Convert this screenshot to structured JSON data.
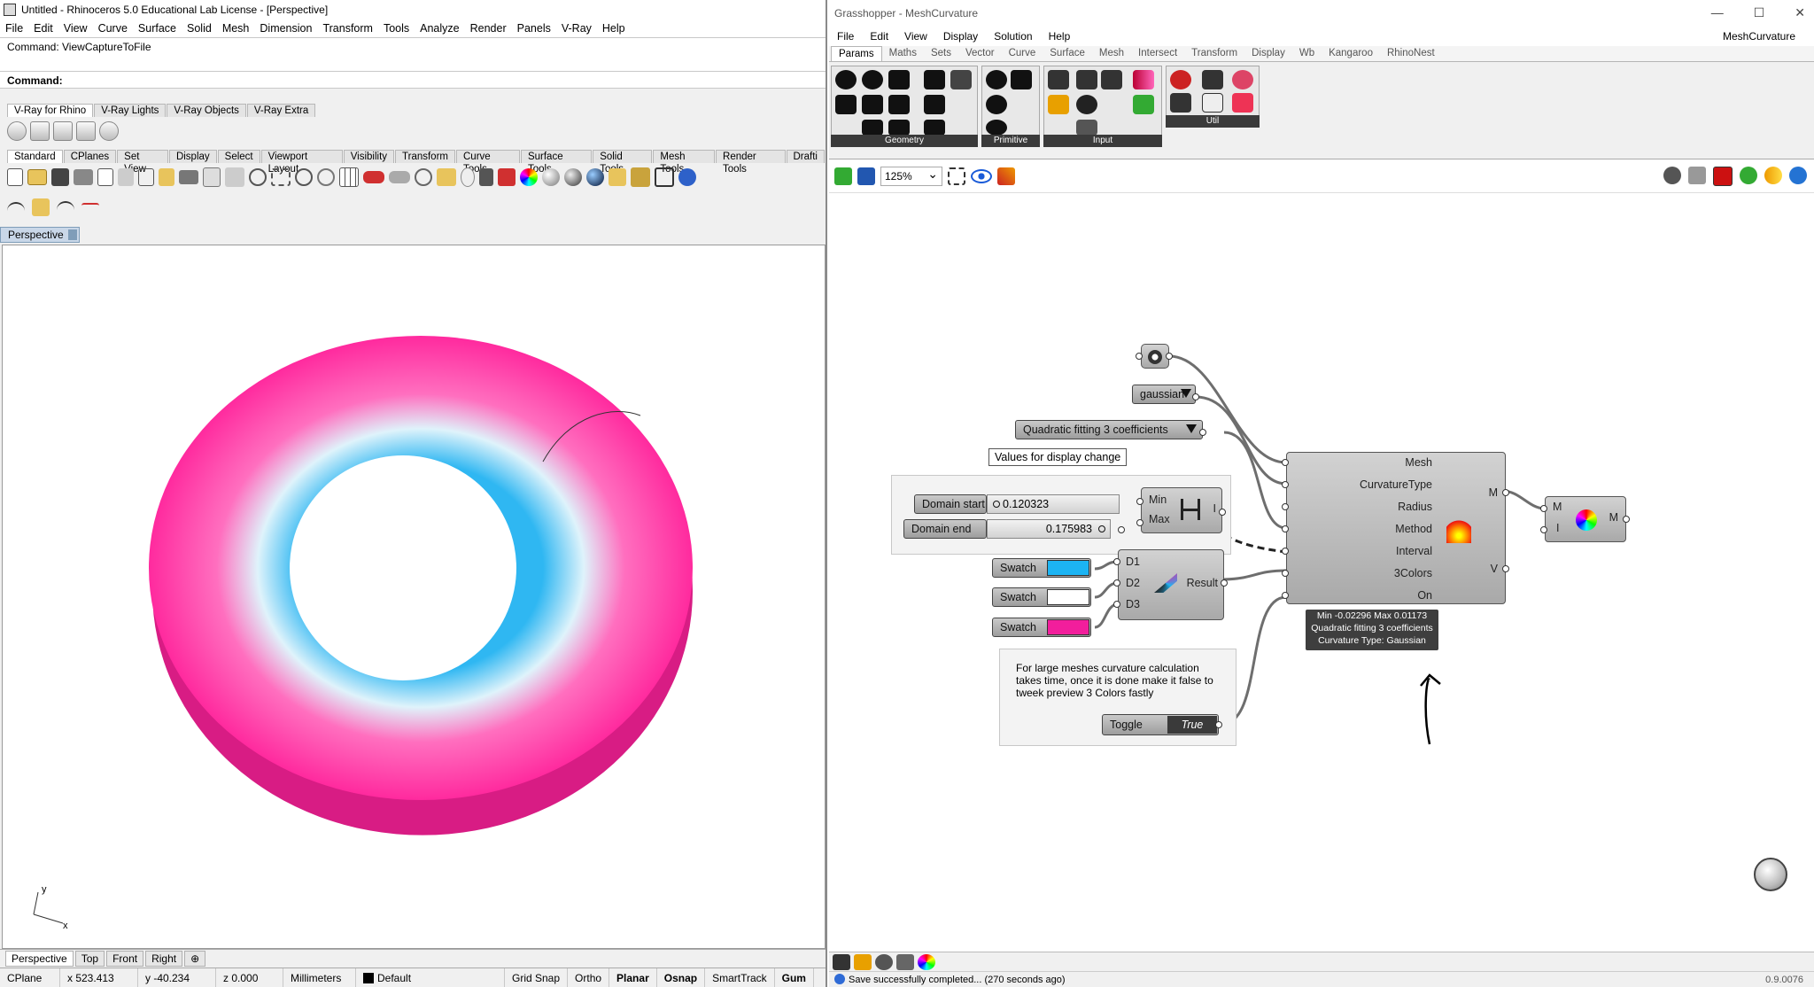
{
  "rhino": {
    "title": "Untitled - Rhinoceros 5.0 Educational Lab License - [Perspective]",
    "menu": [
      "File",
      "Edit",
      "View",
      "Curve",
      "Surface",
      "Solid",
      "Mesh",
      "Dimension",
      "Transform",
      "Tools",
      "Analyze",
      "Render",
      "Panels",
      "V-Ray",
      "Help"
    ],
    "command_history": "Command: ViewCaptureToFile",
    "command_prompt": "Command:",
    "vray_tabs": [
      "V-Ray for Rhino",
      "V-Ray Lights",
      "V-Ray Objects",
      "V-Ray Extra"
    ],
    "toolbar_tabs": [
      "Standard",
      "CPlanes",
      "Set View",
      "Display",
      "Select",
      "Viewport Layout",
      "Visibility",
      "Transform",
      "Curve Tools",
      "Surface Tools",
      "Solid Tools",
      "Mesh Tools",
      "Render Tools",
      "Drafti"
    ],
    "viewport_label": "Perspective",
    "axis_x": "x",
    "axis_y": "y",
    "view_tabs": [
      "Perspective",
      "Top",
      "Front",
      "Right"
    ],
    "add_view_symbol": "⊕",
    "status": {
      "cplane": "CPlane",
      "x": "x 523.413",
      "y": "y -40.234",
      "z": "z 0.000",
      "units": "Millimeters",
      "layer": "Default",
      "grid_snap": "Grid Snap",
      "ortho": "Ortho",
      "planar": "Planar",
      "osnap": "Osnap",
      "smarttrack": "SmartTrack",
      "gumball": "Gum"
    },
    "colors": {
      "pink": "#ff3fa8",
      "cyan": "#2fb7f2",
      "white": "#ffffff"
    }
  },
  "gh": {
    "title": "Grasshopper - MeshCurvature",
    "window_controls": [
      "—",
      "☐",
      "✕"
    ],
    "menu": [
      "File",
      "Edit",
      "View",
      "Display",
      "Solution",
      "Help"
    ],
    "doc_name": "MeshCurvature",
    "tabs": [
      "Params",
      "Maths",
      "Sets",
      "Vector",
      "Curve",
      "Surface",
      "Mesh",
      "Intersect",
      "Transform",
      "Display",
      "Wb",
      "Kangaroo",
      "RhinoNest"
    ],
    "panels": {
      "geometry": "Geometry",
      "primitive": "Primitive",
      "input": "Input",
      "util": "Util"
    },
    "zoom": "125%",
    "nodes": {
      "dropdown_type": "gaussian",
      "dropdown_method": "Quadratic fitting 3 coefficients",
      "values_label": "Values for display change",
      "domain_start_label": "Domain start",
      "domain_start_value": "0.120323",
      "domain_end_label": "Domain end",
      "domain_end_value": "0.175983",
      "construct_domain": {
        "in1": "Min",
        "in2": "Max",
        "out": "I"
      },
      "swatches": [
        "Swatch",
        "Swatch",
        "Swatch"
      ],
      "swatch_colors": [
        "#1cb4f3",
        "#ffffff",
        "#f21e9c"
      ],
      "gradient": {
        "in": [
          "D1",
          "D2",
          "D3"
        ],
        "out": "Result"
      },
      "curvature": {
        "inputs": [
          "Mesh",
          "CurvatureType",
          "Radius",
          "Method",
          "Interval",
          "3Colors",
          "On"
        ],
        "outputs": [
          "M",
          "V"
        ],
        "info": [
          "Min -0.02296 Max 0.01173",
          "Quadratic fitting 3 coefficients",
          "Curvature Type: Gaussian"
        ]
      },
      "preview": {
        "in": [
          "M",
          "I"
        ],
        "out": "M"
      },
      "note": "For large meshes curvature calculation takes time, once it is done make it false to tweek preview 3 Colors fastly",
      "toggle_label": "Toggle",
      "toggle_value": "True"
    },
    "status": "Save successfully completed... (270 seconds ago)",
    "version": "0.9.0076"
  }
}
